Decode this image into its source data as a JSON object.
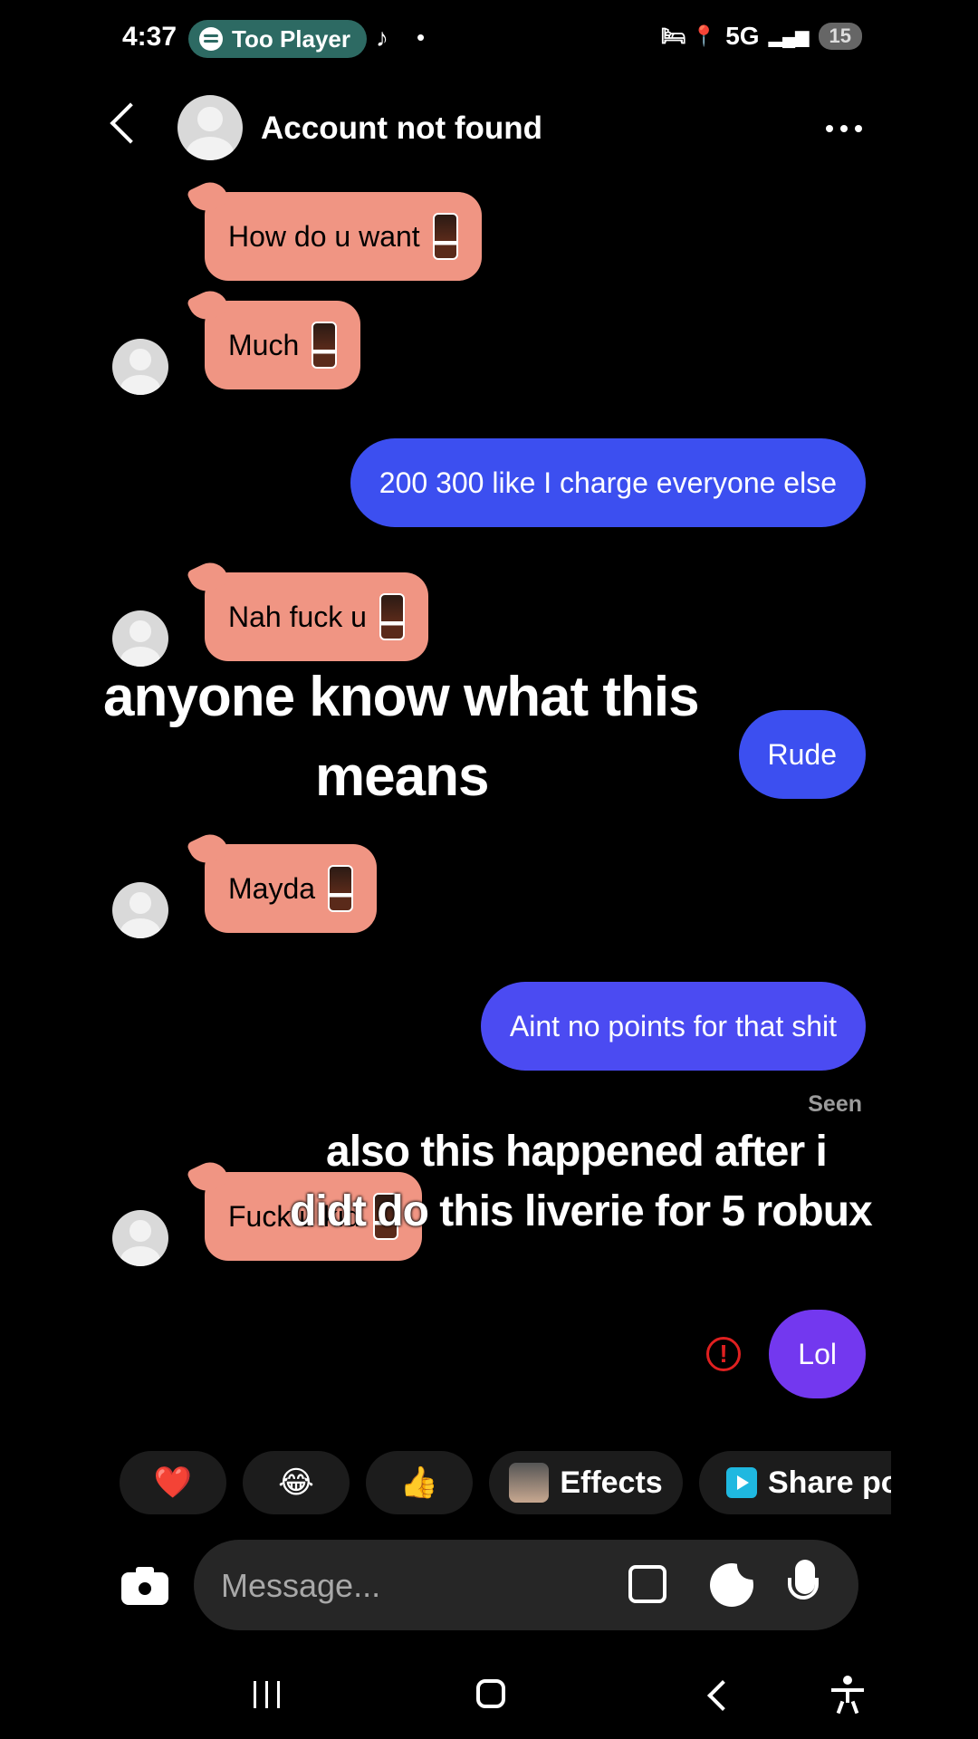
{
  "status_bar": {
    "time": "4:37",
    "media_pill": "Too Player",
    "network": "5G",
    "battery": "15",
    "extra_icons": "🛏 📍",
    "tiktok_glyph": "♪",
    "dot": "•"
  },
  "header": {
    "title": "Account not found"
  },
  "messages": [
    {
      "side": "in",
      "text": "How do u want"
    },
    {
      "side": "in",
      "text": "Much"
    },
    {
      "side": "out",
      "text": "200 300 like I charge everyone else"
    },
    {
      "side": "in",
      "text": "Nah fuck u"
    },
    {
      "side": "out",
      "text": "Rude"
    },
    {
      "side": "in",
      "text": "Mayda"
    },
    {
      "side": "out",
      "text": "Aint no points for that shit"
    },
    {
      "side": "in",
      "text": "Fuck u kid"
    },
    {
      "side": "out",
      "text": "Lol",
      "status": "failed"
    }
  ],
  "seen_label": "Seen",
  "overlay_captions": {
    "line1": "anyone know what this",
    "line2": "means",
    "line3": "also this happened after i",
    "line4": "didt do this liverie for 5 robux"
  },
  "error_glyph": "!",
  "quick_actions": {
    "heart": "❤️",
    "laugh": "😂",
    "thumbs": "👍",
    "effects": "Effects",
    "share": "Share post"
  },
  "composer": {
    "placeholder": "Message..."
  },
  "colors": {
    "incoming_bubble": "#f09583",
    "outgoing_blue": "#3c4ff0",
    "outgoing_purple": "#7338ef",
    "status_pill": "#2d6a63",
    "error": "#e02020"
  }
}
